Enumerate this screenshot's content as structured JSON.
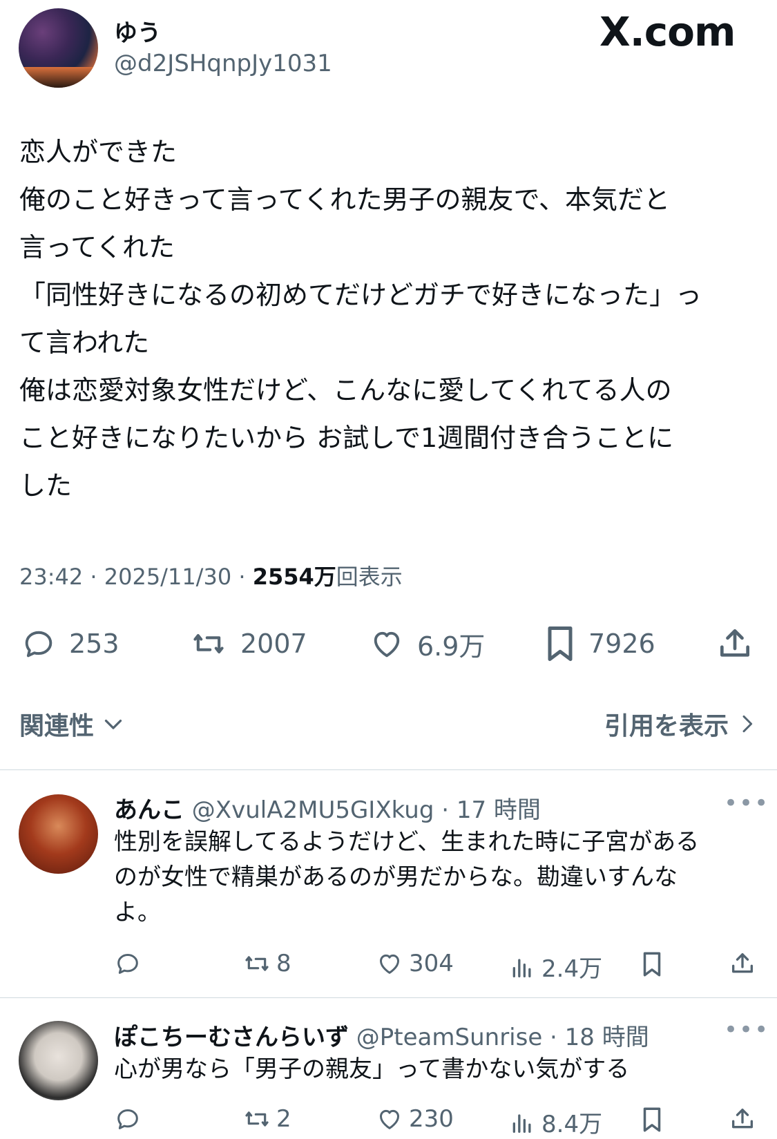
{
  "brand": "X.com",
  "post": {
    "author_name": "ゆう",
    "author_handle": "@d2JSHqnpJy1031",
    "text_lines": [
      "恋人ができた",
      "俺のこと好きって言ってくれた男子の親友で、本気だと",
      "言ってくれた",
      "「同性好きになるの初めてだけどガチで好きになった」っ",
      "て言われた",
      "俺は恋愛対象女性だけど、こんなに愛してくれてる人の",
      "こと好きになりたいから お試しで1週間付き合うことに",
      "した"
    ],
    "time": "23:42 · 2025/11/30 · ",
    "views_count": "2554万",
    "views_label": "回表示",
    "replies": "253",
    "reposts": "2007",
    "likes": "6.9万",
    "bookmarks": "7926"
  },
  "filter": {
    "sort_label": "関連性",
    "quotes_label": "引用を表示"
  },
  "replies": [
    {
      "name": "あんこ",
      "meta": " @XvulA2MU5GIXkug · 17 時間",
      "lines": [
        "性別を誤解してるようだけど、生まれた時に子宮がある",
        "のが女性で精巣があるのが男だからな。勘違いすんな",
        "よ。"
      ],
      "reposts": "8",
      "likes": "304",
      "views": "2.4万",
      "more": "•••"
    },
    {
      "name": "ぽこちーむさんらいず",
      "meta": " @PteamSunrise · 18 時間",
      "lines": [
        "心が男なら「男子の親友」って書かない気がする"
      ],
      "reposts": "2",
      "likes": "230",
      "views": "8.4万",
      "more": "•••"
    }
  ],
  "colors": {
    "text": "#0f1419",
    "secondary": "#536471",
    "divider": "#cfd9de"
  }
}
